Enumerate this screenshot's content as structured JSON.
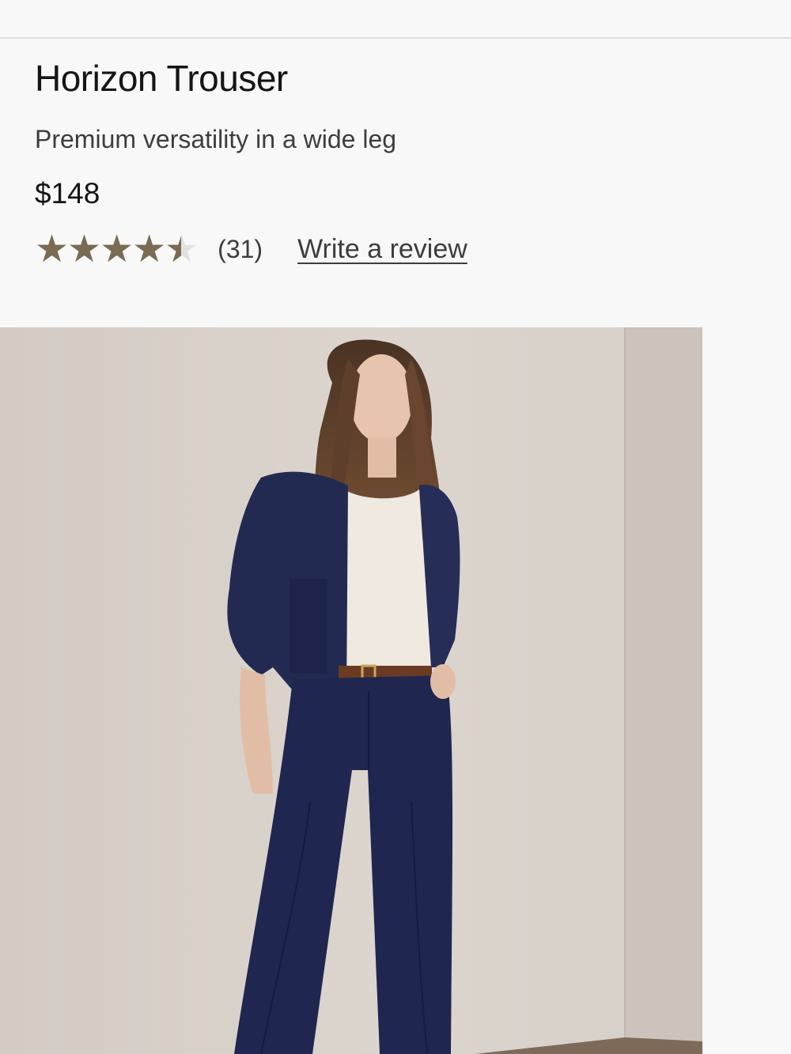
{
  "product": {
    "title": "Horizon Trouser",
    "subtitle": "Premium versatility in a wide leg",
    "price": "$148",
    "rating": {
      "value": 4.5,
      "max": 5,
      "stars_glyph": "★★★★★",
      "count_label": "(31)"
    },
    "write_review_label": "Write a review",
    "image": {
      "subject": "model wearing navy cropped jacket, white tee, brown belt and navy wide-leg trousers"
    }
  },
  "colors": {
    "star_fill": "#7a6b52",
    "star_empty": "#e4e2e0",
    "background": "#f9f8f9",
    "navy": "#232a52",
    "wall": "#d6cfc9"
  }
}
